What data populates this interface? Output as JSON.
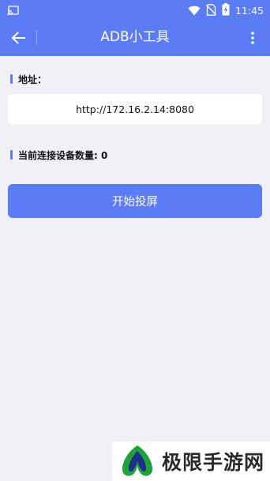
{
  "status_bar": {
    "time": "11:45",
    "icons": [
      "cast-icon",
      "wifi-icon",
      "no-sim-icon",
      "battery-charging-icon"
    ]
  },
  "app_bar": {
    "title": "ADB小工具",
    "back_icon": "arrow-back-icon",
    "menu_icon": "more-vertical-icon"
  },
  "address": {
    "label": "地址：",
    "value": "http://172.16.2.14:8080"
  },
  "devices": {
    "label": "当前连接设备数量: 0"
  },
  "actions": {
    "start_label": "开始投屏"
  },
  "watermark": {
    "text": "极限手游网"
  },
  "colors": {
    "accent": "#5b7cf4",
    "background": "#f1f0f6",
    "card": "#ffffff",
    "logo_green": "#1fa23a",
    "logo_navy": "#1f2f8a"
  }
}
